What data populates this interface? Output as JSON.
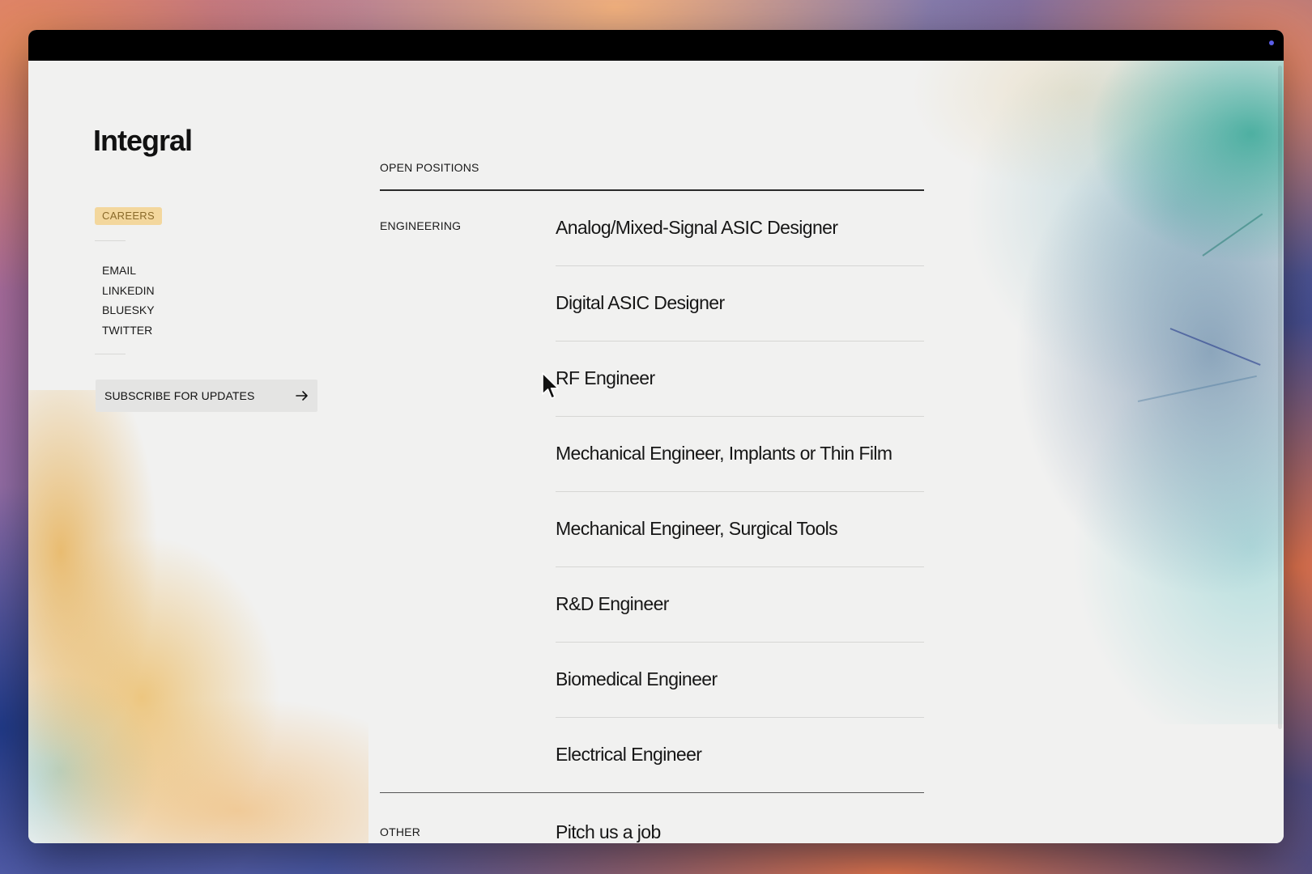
{
  "brand": {
    "logo_text": "Integral",
    "section_badge": "CAREERS"
  },
  "social_links": [
    {
      "label": "EMAIL"
    },
    {
      "label": "LINKEDIN"
    },
    {
      "label": "BLUESKY"
    },
    {
      "label": "TWITTER"
    }
  ],
  "subscribe": {
    "label": "SUBSCRIBE FOR UPDATES",
    "icon": "arrow-right-icon"
  },
  "positions": {
    "header": "OPEN POSITIONS",
    "categories": [
      {
        "name": "ENGINEERING",
        "jobs": [
          "Analog/Mixed-Signal ASIC Designer",
          "Digital ASIC Designer",
          "RF Engineer",
          "Mechanical Engineer, Implants or Thin Film",
          "Mechanical Engineer, Surgical Tools",
          "R&D Engineer",
          "Biomedical Engineer",
          "Electrical Engineer"
        ]
      },
      {
        "name": "OTHER",
        "jobs": [
          "Pitch us a job"
        ]
      }
    ]
  },
  "colors": {
    "badge_background": "#f3d79d",
    "badge_text": "#8a6a2a",
    "page_background": "#f1f1f0",
    "text": "#161616"
  }
}
